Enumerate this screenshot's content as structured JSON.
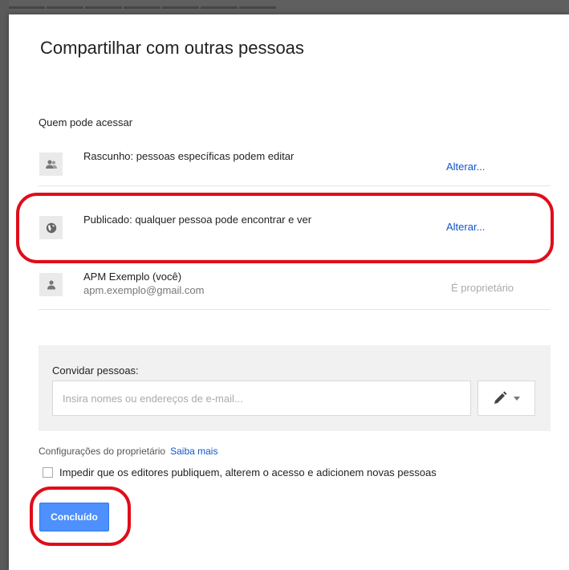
{
  "dialog": {
    "title": "Compartilhar com outras pessoas",
    "section_label": "Quem pode acessar"
  },
  "access_rows": [
    {
      "icon": "people-icon",
      "text": "Rascunho: pessoas específicas podem editar",
      "action": "Alterar..."
    },
    {
      "icon": "globe-icon",
      "text": "Publicado: qualquer pessoa pode encontrar e ver",
      "action": "Alterar..."
    },
    {
      "icon": "person-icon",
      "name": "APM Exemplo (você)",
      "email": "apm.exemplo@gmail.com",
      "role": "É proprietário"
    }
  ],
  "invite": {
    "label": "Convidar pessoas:",
    "placeholder": "Insira nomes ou endereços de e-mail...",
    "value": ""
  },
  "owner_settings": {
    "label": "Configurações do proprietário",
    "link": "Saiba mais",
    "checkbox_label": "Impedir que os editores publiquem, alterem o acesso e adicionem novas pessoas",
    "checked": false
  },
  "done_button": "Concluído",
  "colors": {
    "link": "#1155cc",
    "primary_button": "#4d90fe",
    "annotation": "#e00d1a"
  }
}
